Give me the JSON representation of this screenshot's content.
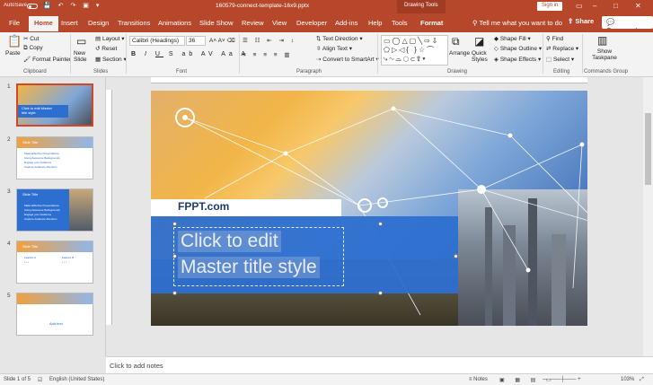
{
  "titlebar": {
    "autosave": "AutoSave",
    "autosave_state": "Off",
    "document_name": "160579-connect-template-16x9.pptx",
    "context_tools": "Drawing Tools",
    "signin": "Sign in"
  },
  "tabs": [
    "File",
    "Home",
    "Insert",
    "Design",
    "Transitions",
    "Animations",
    "Slide Show",
    "Review",
    "View",
    "Developer",
    "Add-ins",
    "Help",
    "Tools",
    "Format"
  ],
  "tellme": "Tell me what you want to do",
  "share": "Share",
  "comments": "Comments",
  "ribbon": {
    "clipboard": {
      "paste": "Paste",
      "cut": "Cut",
      "copy": "Copy",
      "format_painter": "Format Painter",
      "label": "Clipboard"
    },
    "slides": {
      "new_slide": "New Slide",
      "layout": "Layout",
      "reset": "Reset",
      "section": "Section",
      "label": "Slides"
    },
    "font": {
      "name": "Calibri (Headings)",
      "size": "36",
      "label": "Font"
    },
    "paragraph": {
      "text_direction": "Text Direction",
      "align_text": "Align Text",
      "convert_smartart": "Convert to SmartArt",
      "label": "Paragraph"
    },
    "drawing": {
      "arrange": "Arrange",
      "quick_styles": "Quick Styles",
      "shape_fill": "Shape Fill",
      "shape_outline": "Shape Outline",
      "shape_effects": "Shape Effects",
      "label": "Drawing"
    },
    "editing": {
      "find": "Find",
      "replace": "Replace",
      "select": "Select",
      "label": "Editing"
    },
    "commands": {
      "show_taskpane": "Show Taskpane",
      "label": "Commands Group"
    }
  },
  "thumbnails": [
    {
      "num": "1",
      "title": "Click to edit Master title style"
    },
    {
      "num": "2",
      "title": "Slide Title",
      "bullets": [
        "Make Effective Presentations",
        "Using Awesome Backgrounds",
        "Engage your Audience",
        "Capture Audience Attention"
      ]
    },
    {
      "num": "3",
      "title": "Slide Title",
      "bullets": [
        "Make Effective Presentations",
        "Using Awesome Backgrounds",
        "Engage your Audience",
        "Capture Audience Attention"
      ]
    },
    {
      "num": "4",
      "title": "Slide Title",
      "bullets": [
        "Feature A",
        "Feature B"
      ]
    },
    {
      "num": "5",
      "title": "",
      "center": "Add text"
    }
  ],
  "slide": {
    "brand": "FPPT.com",
    "title_line1": "Click to edit",
    "title_line2": "Master title style"
  },
  "notes_placeholder": "Click to add notes",
  "status": {
    "slide_of": "Slide 1 of 5",
    "language": "English (United States)",
    "notes": "Notes",
    "zoom": "103%"
  }
}
